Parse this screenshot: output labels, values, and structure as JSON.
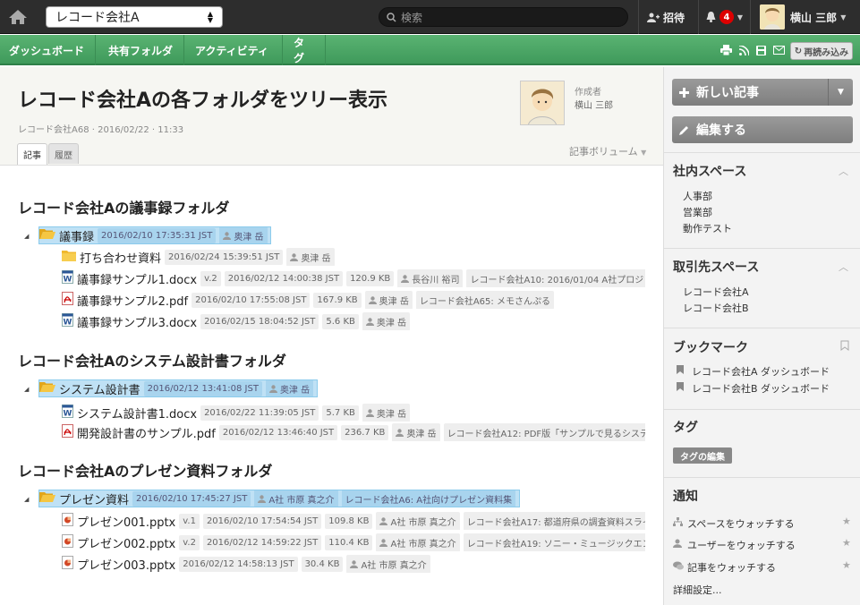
{
  "topbar": {
    "space_select_value": "レコード会社A",
    "search_placeholder": "検索",
    "invite_label": "招待",
    "notification_count": "4",
    "user_name": "横山 三郎"
  },
  "nav": {
    "tabs": [
      "ダッシュボード",
      "共有フォルダ",
      "アクティビティ",
      "タグ"
    ],
    "reload_label": "再読み込み"
  },
  "article": {
    "title": "レコード会社Aの各フォルダをツリー表示",
    "meta": "レコード会社A68 · 2016/02/22 · 11:33",
    "author_label": "作成者",
    "author_name": "横山 三郎",
    "tabs": {
      "article": "記事",
      "history": "履歴"
    },
    "volume_label": "記事ボリューム"
  },
  "sections": [
    {
      "heading": "レコード会社Aの議事録フォルダ",
      "folder": {
        "name": "議事録",
        "tags": [
          "2016/02/10 17:35:31 JST",
          "奥津 岳"
        ]
      },
      "items": [
        {
          "icon": "folder",
          "name": "打ち合わせ資料",
          "tags": [
            "2016/02/24 15:39:51 JST",
            "奥津 岳"
          ]
        },
        {
          "icon": "word",
          "name": "議事録サンプル1.docx",
          "tags": [
            "v.2",
            "2016/02/12 14:00:38 JST",
            "120.9 KB",
            "長谷川 裕司",
            "レコード会社A10: 2016/01/04 A社プロジ"
          ]
        },
        {
          "icon": "pdf",
          "name": "議事録サンプル2.pdf",
          "tags": [
            "2016/02/10 17:55:08 JST",
            "167.9 KB",
            "奥津 岳",
            "レコード会社A65: メモさんぷる"
          ]
        },
        {
          "icon": "word",
          "name": "議事録サンプル3.docx",
          "tags": [
            "2016/02/15 18:04:52 JST",
            "5.6 KB",
            "奥津 岳"
          ]
        }
      ]
    },
    {
      "heading": "レコード会社Aのシステム設計書フォルダ",
      "folder": {
        "name": "システム設計書",
        "tags": [
          "2016/02/12 13:41:08 JST",
          "奥津 岳"
        ]
      },
      "items": [
        {
          "icon": "word",
          "name": "システム設計書1.docx",
          "tags": [
            "2016/02/22 11:39:05 JST",
            "5.7 KB",
            "奥津 岳"
          ]
        },
        {
          "icon": "pdf",
          "name": "開発設計書のサンプル.pdf",
          "tags": [
            "2016/02/12 13:46:40 JST",
            "236.7 KB",
            "奥津 岳",
            "レコード会社A12: PDF版「サンプルで見るシステ"
          ]
        }
      ]
    },
    {
      "heading": "レコード会社Aのプレゼン資料フォルダ",
      "folder": {
        "name": "プレゼン資料",
        "tags": [
          "2016/02/10 17:45:27 JST",
          "A社 市原 真之介",
          "レコード会社A6: A社向けプレゼン資料集"
        ]
      },
      "items": [
        {
          "icon": "ppt",
          "name": "プレゼン001.pptx",
          "tags": [
            "v.1",
            "2016/02/10 17:54:54 JST",
            "109.8 KB",
            "A社 市原 真之介",
            "レコード会社A17: 都道府県の調査資料スライ"
          ]
        },
        {
          "icon": "ppt",
          "name": "プレゼン002.pptx",
          "tags": [
            "v.2",
            "2016/02/12 14:59:22 JST",
            "110.4 KB",
            "A社 市原 真之介",
            "レコード会社A19: ソニー・ミュージックエン"
          ]
        },
        {
          "icon": "ppt",
          "name": "プレゼン003.pptx",
          "tags": [
            "2016/02/12 14:58:13 JST",
            "30.4 KB",
            "A社 市原 真之介"
          ]
        }
      ]
    }
  ],
  "sidebar": {
    "new_article": "新しい記事",
    "edit": "編集する",
    "internal_space": {
      "title": "社内スペース",
      "items": [
        "人事部",
        "営業部",
        "動作テスト"
      ]
    },
    "client_space": {
      "title": "取引先スペース",
      "items": [
        "レコード会社A",
        "レコード会社B"
      ]
    },
    "bookmarks": {
      "title": "ブックマーク",
      "items": [
        "レコード会社A ダッシュボード",
        "レコード会社B ダッシュボード"
      ]
    },
    "tags": {
      "title": "タグ",
      "edit": "タグの編集"
    },
    "notifications": {
      "title": "通知",
      "items": [
        "スペースをウォッチする",
        "ユーザーをウォッチする",
        "記事をウォッチする"
      ],
      "detail": "詳細設定..."
    }
  },
  "colors": {
    "nav_green": "#4aa865",
    "highlight_blue": "#bfe1f5",
    "topbar": "#2d2d2d"
  }
}
